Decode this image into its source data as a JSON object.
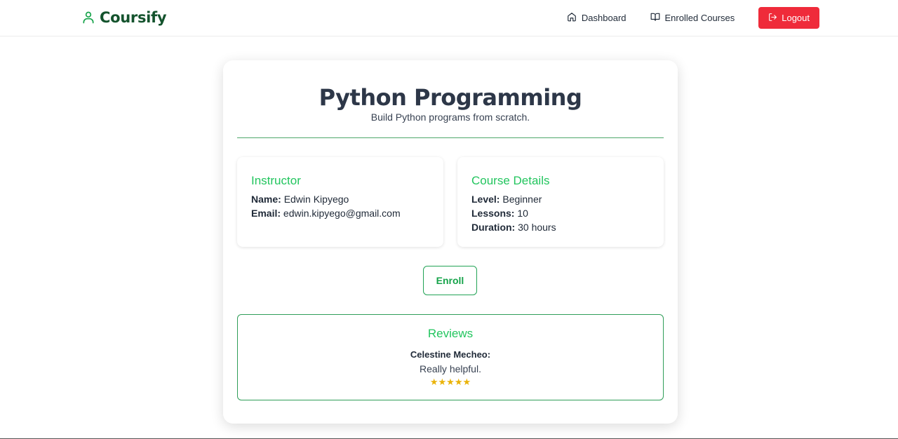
{
  "brand": {
    "name": "Coursify",
    "icon": "user-icon",
    "color": "#16a34a"
  },
  "nav": {
    "dashboard_label": "Dashboard",
    "enrolled_label": "Enrolled Courses",
    "logout_label": "Logout",
    "logout_color": "#ef2b3a"
  },
  "course": {
    "title": "Python Programming",
    "subtitle": "Build Python programs from scratch."
  },
  "instructor": {
    "heading": "Instructor",
    "name_label": "Name:",
    "name": "Edwin Kipyego",
    "email_label": "Email:",
    "email": "edwin.kipyego@gmail.com"
  },
  "details": {
    "heading": "Course Details",
    "level_label": "Level:",
    "level": "Beginner",
    "lessons_label": "Lessons:",
    "lessons": "10",
    "duration_label": "Duration:",
    "duration": "30 hours"
  },
  "enroll_label": "Enroll",
  "reviews": {
    "title": "Reviews",
    "items": [
      {
        "author": "Celestine Mecheo:",
        "text": "Really helpful.",
        "stars": "★★★★★"
      }
    ]
  },
  "accent_color": "#22c55e"
}
